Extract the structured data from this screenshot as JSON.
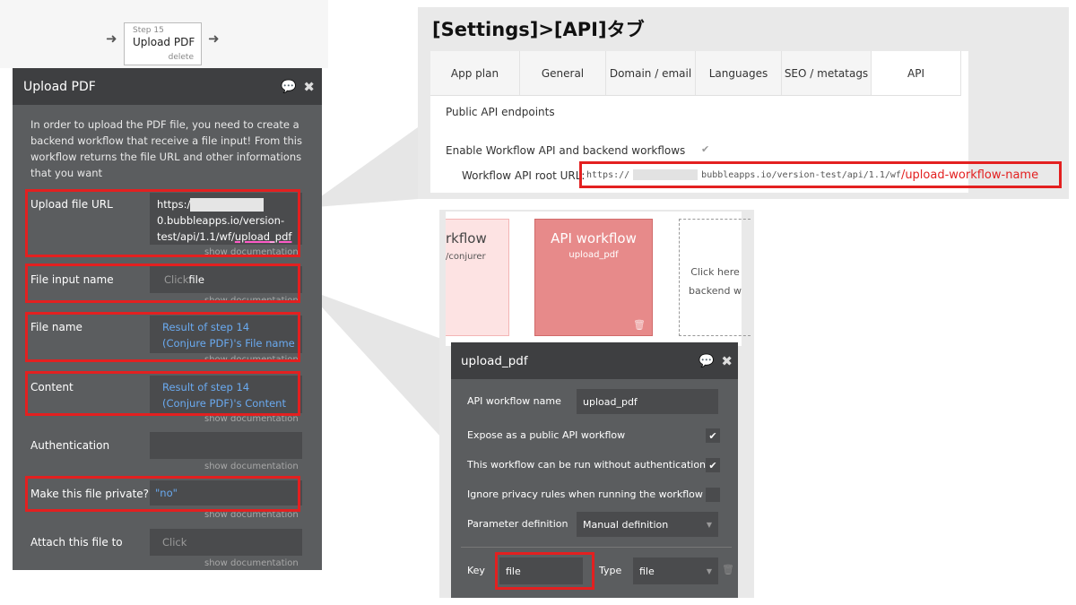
{
  "step": {
    "number": "Step 15",
    "title": "Upload PDF",
    "delete": "delete"
  },
  "editor": {
    "title": "Upload PDF",
    "description": "In order to upload the PDF file, you need to create a backend workflow that receive a file input! From this workflow returns the file URL and other informations that you want",
    "show_doc": "show documentation",
    "upload_url": {
      "label": "Upload file URL",
      "prefix": "https:/",
      "suffix": "0.bubbleapps.io/version-test/api/1.1/wf/",
      "highlight": "upload_pdf"
    },
    "file_input": {
      "label": "File input name",
      "placeholder": "Click",
      "value": "file"
    },
    "file_name": {
      "label": "File name",
      "value": "Result of step 14 (Conjure PDF)'s File name"
    },
    "content": {
      "label": "Content",
      "value": "Result of step 14 (Conjure PDF)'s Content"
    },
    "authentication": {
      "label": "Authentication",
      "value": ""
    },
    "private": {
      "label": "Make this file private?",
      "value": "\"no\""
    },
    "attach": {
      "label": "Attach this file to",
      "placeholder": "Click"
    }
  },
  "settings": {
    "heading": "[Settings]>[API]タブ",
    "tabs": [
      {
        "label": "App plan",
        "active": false
      },
      {
        "label": "General",
        "active": false
      },
      {
        "label": "Domain / email",
        "active": false
      },
      {
        "label": "Languages",
        "active": false
      },
      {
        "label": "SEO / metatags",
        "active": false
      },
      {
        "label": "API",
        "active": true
      }
    ],
    "public_endpoints": "Public API endpoints",
    "enable_label": "Enable Workflow API and backend workflows",
    "root_label": "Workflow API root URL:",
    "root_prefix": "https://",
    "root_mid": "bubbleapps.io/version-test/api/1.1/wf",
    "root_highlight": "/upload-workflow-name"
  },
  "workflow_canvas": {
    "partial_card": {
      "title": "rkflow",
      "sub": "/conjurer"
    },
    "api_card": {
      "title": "API workflow",
      "sub": "upload_pdf"
    },
    "new_card_text": "Click here backend w"
  },
  "api_editor": {
    "title": "upload_pdf",
    "name_label": "API workflow name",
    "name_value": "upload_pdf",
    "expose_label": "Expose as a public API workflow",
    "expose_checked": true,
    "no_auth_label": "This workflow can be run without authentication",
    "no_auth_checked": true,
    "ignore_privacy_label": "Ignore privacy rules when running the workflow",
    "ignore_privacy_checked": false,
    "param_label": "Parameter definition",
    "param_value": "Manual definition",
    "key_label": "Key",
    "key_value": "file",
    "type_label": "Type",
    "type_value": "file"
  },
  "colors": {
    "highlight_red": "#e32020",
    "editor_bg": "#5b5d5f",
    "editor_header": "#3e3f41",
    "link_blue": "#6aaaf0",
    "api_card": "#e78a8a"
  }
}
